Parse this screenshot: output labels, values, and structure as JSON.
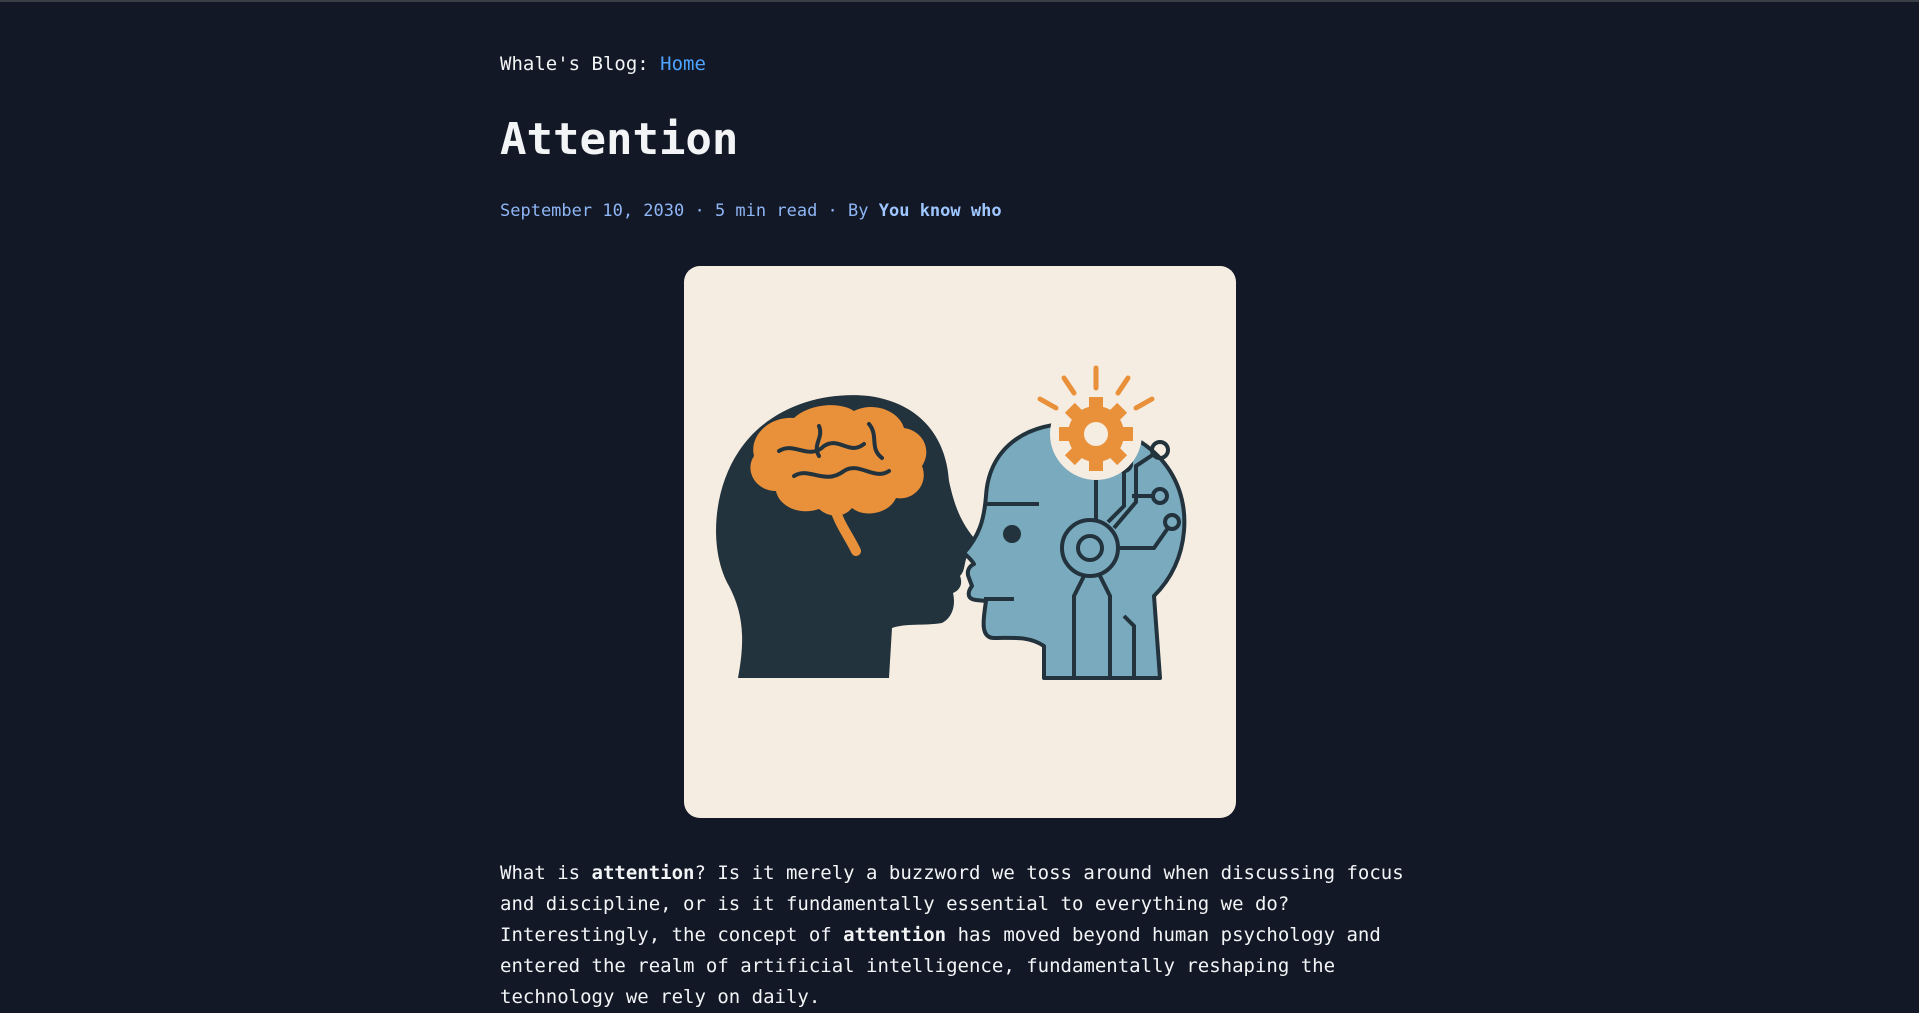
{
  "header": {
    "blog_name": "Whale's Blog: ",
    "home_label": "Home"
  },
  "post": {
    "title": "Attention",
    "date": "September 10, 2030",
    "sep1": " · ",
    "read_time": "5 min read",
    "sep2": " · ",
    "by_label": "By ",
    "author": "You know who"
  },
  "body": {
    "p1_a": "What is ",
    "p1_b": "attention",
    "p1_c": "? Is it merely a buzzword we toss around when discussing focus and discipline, or is it fundamentally essential to everything we do? Interestingly, the concept of ",
    "p1_d": "attention",
    "p1_e": " has moved beyond human psychology and entered the realm of artificial intelligence, fundamentally reshaping the technology we rely on daily."
  },
  "colors": {
    "background": "#121826",
    "accent_link": "#4da3ff",
    "meta": "#8fb6f5",
    "illustration_bg": "#f6ede2",
    "brain_orange": "#e8903a",
    "head_dark": "#22333d",
    "robot_blue": "#7aaabd"
  }
}
